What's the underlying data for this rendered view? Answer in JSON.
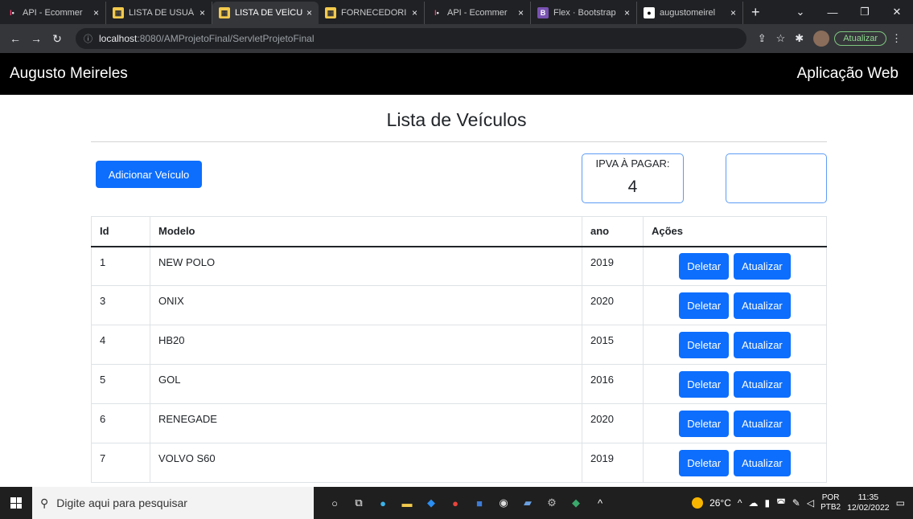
{
  "browser": {
    "tabs": [
      {
        "favicon": "api-favicon",
        "label": "API - Ecommer",
        "active": false
      },
      {
        "favicon": "lista-favicon",
        "label": "LISTA DE USUÁ",
        "active": false
      },
      {
        "favicon": "lista-favicon",
        "label": "LISTA DE VEÍCU",
        "active": true
      },
      {
        "favicon": "lista-favicon",
        "label": "FORNECEDORI",
        "active": false
      },
      {
        "favicon": "api-favicon",
        "label": "API - Ecommer",
        "active": false
      },
      {
        "favicon": "bootstrap-favicon",
        "label": "Flex · Bootstrap",
        "active": false
      },
      {
        "favicon": "github-favicon",
        "label": "augustomeirel",
        "active": false
      }
    ],
    "tab_close_glyph": "×",
    "new_tab_glyph": "+",
    "url_host": "localhost",
    "url_path": ":8080/AMProjetoFinal/ServletProjetoFinal",
    "update_label": "Atualizar"
  },
  "navbar": {
    "brand": "Augusto Meireles",
    "right_text": "Aplicação Web"
  },
  "page": {
    "title": "Lista de Veículos",
    "add_button": "Adicionar Veículo",
    "ipva_label": "IPVA À PAGAR:",
    "ipva_value": "4"
  },
  "table": {
    "headers": {
      "id": "Id",
      "model": "Modelo",
      "year": "ano",
      "actions": "Ações"
    },
    "delete_label": "Deletar",
    "update_label": "Atualizar",
    "rows": [
      {
        "id": "1",
        "model": "NEW POLO",
        "year": "2019"
      },
      {
        "id": "3",
        "model": "ONIX",
        "year": "2020"
      },
      {
        "id": "4",
        "model": "HB20",
        "year": "2015"
      },
      {
        "id": "5",
        "model": "GOL",
        "year": "2016"
      },
      {
        "id": "6",
        "model": "RENEGADE",
        "year": "2020"
      },
      {
        "id": "7",
        "model": "VOLVO S60",
        "year": "2019"
      }
    ]
  },
  "taskbar": {
    "search_placeholder": "Digite aqui para pesquisar",
    "weather": "26°C",
    "lang_top": "POR",
    "lang_bottom": "PTB2",
    "time": "11:35",
    "date": "12/02/2022"
  }
}
